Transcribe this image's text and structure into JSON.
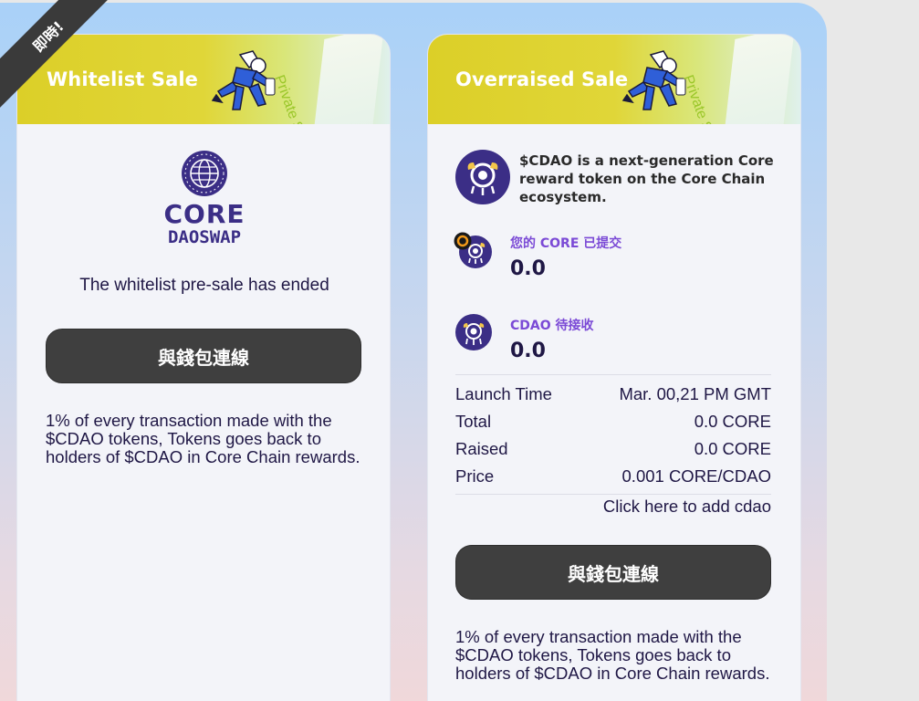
{
  "corner_badge": "即時!",
  "cards": {
    "whitelist": {
      "title": "Whitelist Sale",
      "ribbon": "Private Sale",
      "logo_word": "CORE",
      "logo_sub": "DAOSWAP",
      "status": "The whitelist pre-sale has ended",
      "connect_button": "與錢包連線",
      "fee_note": "1% of every transaction made with the $CDAO tokens, Tokens goes back to holders of $CDAO in Core Chain rewards."
    },
    "overraised": {
      "title": "Overraised Sale",
      "ribbon": "Private Sale",
      "token_description": "$CDAO is a next-generation Core reward token on the Core Chain ecosystem.",
      "core_submitted_label": "您的 CORE 已提交",
      "core_submitted_value": "0.0",
      "cdao_pending_label": "CDAO 待接收",
      "cdao_pending_value": "0.0",
      "info": [
        {
          "label": "Launch Time",
          "value": "Mar. 00,21 PM GMT"
        },
        {
          "label": "Total",
          "value": "0.0 CORE"
        },
        {
          "label": "Raised",
          "value": "0.0 CORE"
        },
        {
          "label": "Price",
          "value": "0.001 CORE/CDAO"
        }
      ],
      "add_token_link": "Click here to add cdao",
      "connect_button": "與錢包連線",
      "fee_note": "1% of every transaction made with the $CDAO tokens, Tokens goes back to holders of $CDAO in Core Chain rewards."
    }
  },
  "colors": {
    "accent_purple": "#3b2e86",
    "label_purple": "#7b4ad6",
    "button_dark": "#3f3f3f",
    "header_yellow": "#dccf28",
    "ribbon_green": "#9bc72a"
  }
}
